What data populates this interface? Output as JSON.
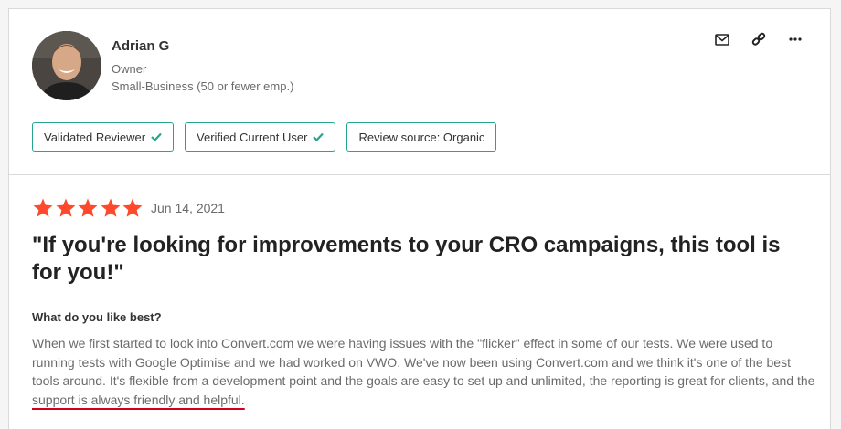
{
  "reviewer": {
    "name": "Adrian G",
    "role": "Owner",
    "company": "Small-Business (50 or fewer emp.)"
  },
  "actions": [
    {
      "icon": "mail-icon"
    },
    {
      "icon": "link-icon"
    },
    {
      "icon": "more-icon"
    }
  ],
  "badges": {
    "validated": "Validated Reviewer",
    "verified": "Verified Current User",
    "source": "Review source: Organic"
  },
  "review": {
    "rating": 5,
    "rating_max": 5,
    "date": "Jun 14, 2021",
    "title": "\"If you're looking for improvements to your CRO campaigns, this tool is for you!\"",
    "question": "What do you like best?",
    "answer_main": "When we first started to look into Convert.com we were having issues with the \"flicker\" effect in some of our tests. We were used to running tests with Google Optimise and we had worked on VWO. We've now been using Convert.com and we think it's one of the best tools around. It's flexible from a development point and the goals are easy to set up and unlimited, the reporting is great for clients, and the ",
    "answer_highlight": "support is always friendly and helpful."
  },
  "colors": {
    "star": "#ff492c",
    "badge_border": "#25a68c",
    "check": "#25a68c",
    "underline": "#d0021b"
  }
}
